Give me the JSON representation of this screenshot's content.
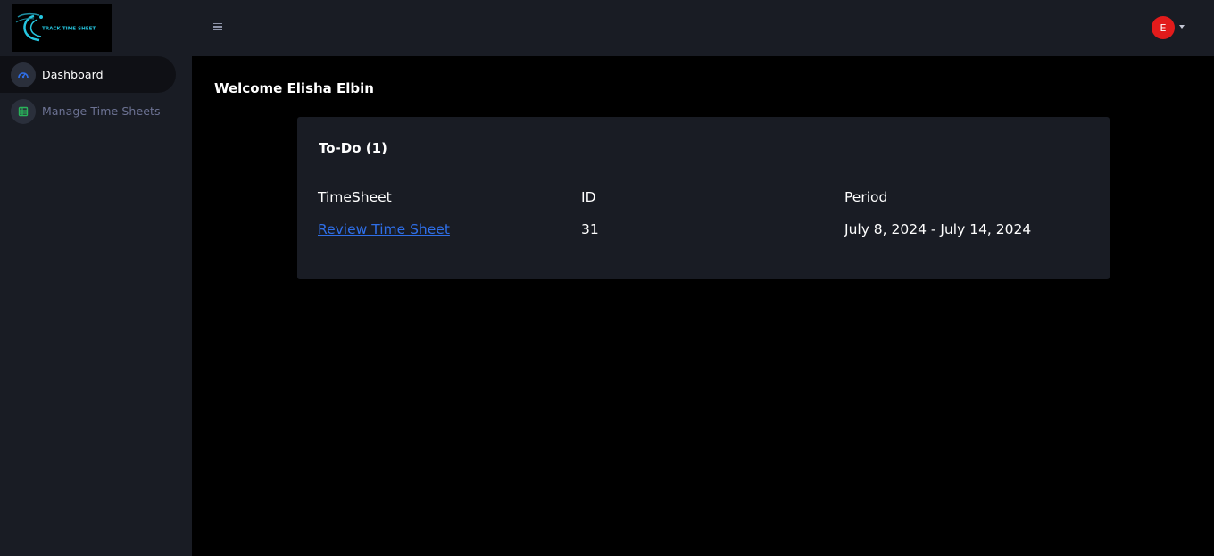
{
  "logo": {
    "text": "TRACK TIME SHEET",
    "accent": "#25c6e0"
  },
  "sidebar": {
    "items": [
      {
        "label": "Dashboard",
        "icon": "speedometer-icon",
        "active": true,
        "icon_color": "#2f6fe8"
      },
      {
        "label": "Manage Time Sheets",
        "icon": "table-icon",
        "active": false,
        "icon_color": "#29b35a"
      }
    ]
  },
  "topbar": {
    "menu_icon": "hamburger-icon",
    "avatar_initial": "E",
    "avatar_color": "#e21b1b",
    "dropdown_icon": "caret-down-icon"
  },
  "main": {
    "welcome": "Welcome Elisha Elbin",
    "todo": {
      "title": "To-Do (1)",
      "columns": [
        "TimeSheet",
        "ID",
        "Period"
      ],
      "rows": [
        {
          "timesheet": "Review Time Sheet",
          "id": "31",
          "period": "July 8, 2024 - July 14, 2024"
        }
      ]
    }
  },
  "colors": {
    "sidebar_bg": "#191c24",
    "content_bg": "#000000",
    "card_bg": "#191c24",
    "link": "#2f6fe8",
    "muted_text": "#6c7293"
  }
}
